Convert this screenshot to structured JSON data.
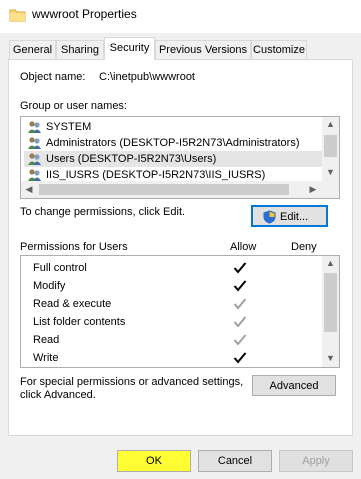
{
  "window": {
    "title": "wwwroot Properties"
  },
  "tabs": [
    "General",
    "Sharing",
    "Security",
    "Previous Versions",
    "Customize"
  ],
  "active_tab": "Security",
  "object": {
    "label": "Object name:",
    "value": "C:\\inetpub\\wwwroot"
  },
  "groups": {
    "label": "Group or user names:",
    "items": [
      "SYSTEM",
      "Administrators (DESKTOP-I5R2N73\\Administrators)",
      "Users (DESKTOP-I5R2N73\\Users)",
      "IIS_IUSRS (DESKTOP-I5R2N73\\IIS_IUSRS)"
    ],
    "selected_index": 2
  },
  "change_text": "To change permissions, click Edit.",
  "edit_button": "Edit...",
  "permissions": {
    "label": "Permissions for Users",
    "allow_header": "Allow",
    "deny_header": "Deny",
    "items": [
      {
        "name": "Full control",
        "allow": "checked",
        "deny": "none"
      },
      {
        "name": "Modify",
        "allow": "checked",
        "deny": "none"
      },
      {
        "name": "Read & execute",
        "allow": "inherited",
        "deny": "none"
      },
      {
        "name": "List folder contents",
        "allow": "inherited",
        "deny": "none"
      },
      {
        "name": "Read",
        "allow": "inherited",
        "deny": "none"
      },
      {
        "name": "Write",
        "allow": "checked",
        "deny": "none"
      }
    ]
  },
  "advanced": {
    "text_line1": "For special permissions or advanced settings,",
    "text_line2": "click Advanced.",
    "button": "Advanced"
  },
  "footer": {
    "ok": "OK",
    "cancel": "Cancel",
    "apply": "Apply"
  },
  "colors": {
    "ok_highlight": "#ffff33",
    "check_dark": "#000000",
    "check_inherited": "#a0a0a0",
    "folder": "#f8d775"
  }
}
